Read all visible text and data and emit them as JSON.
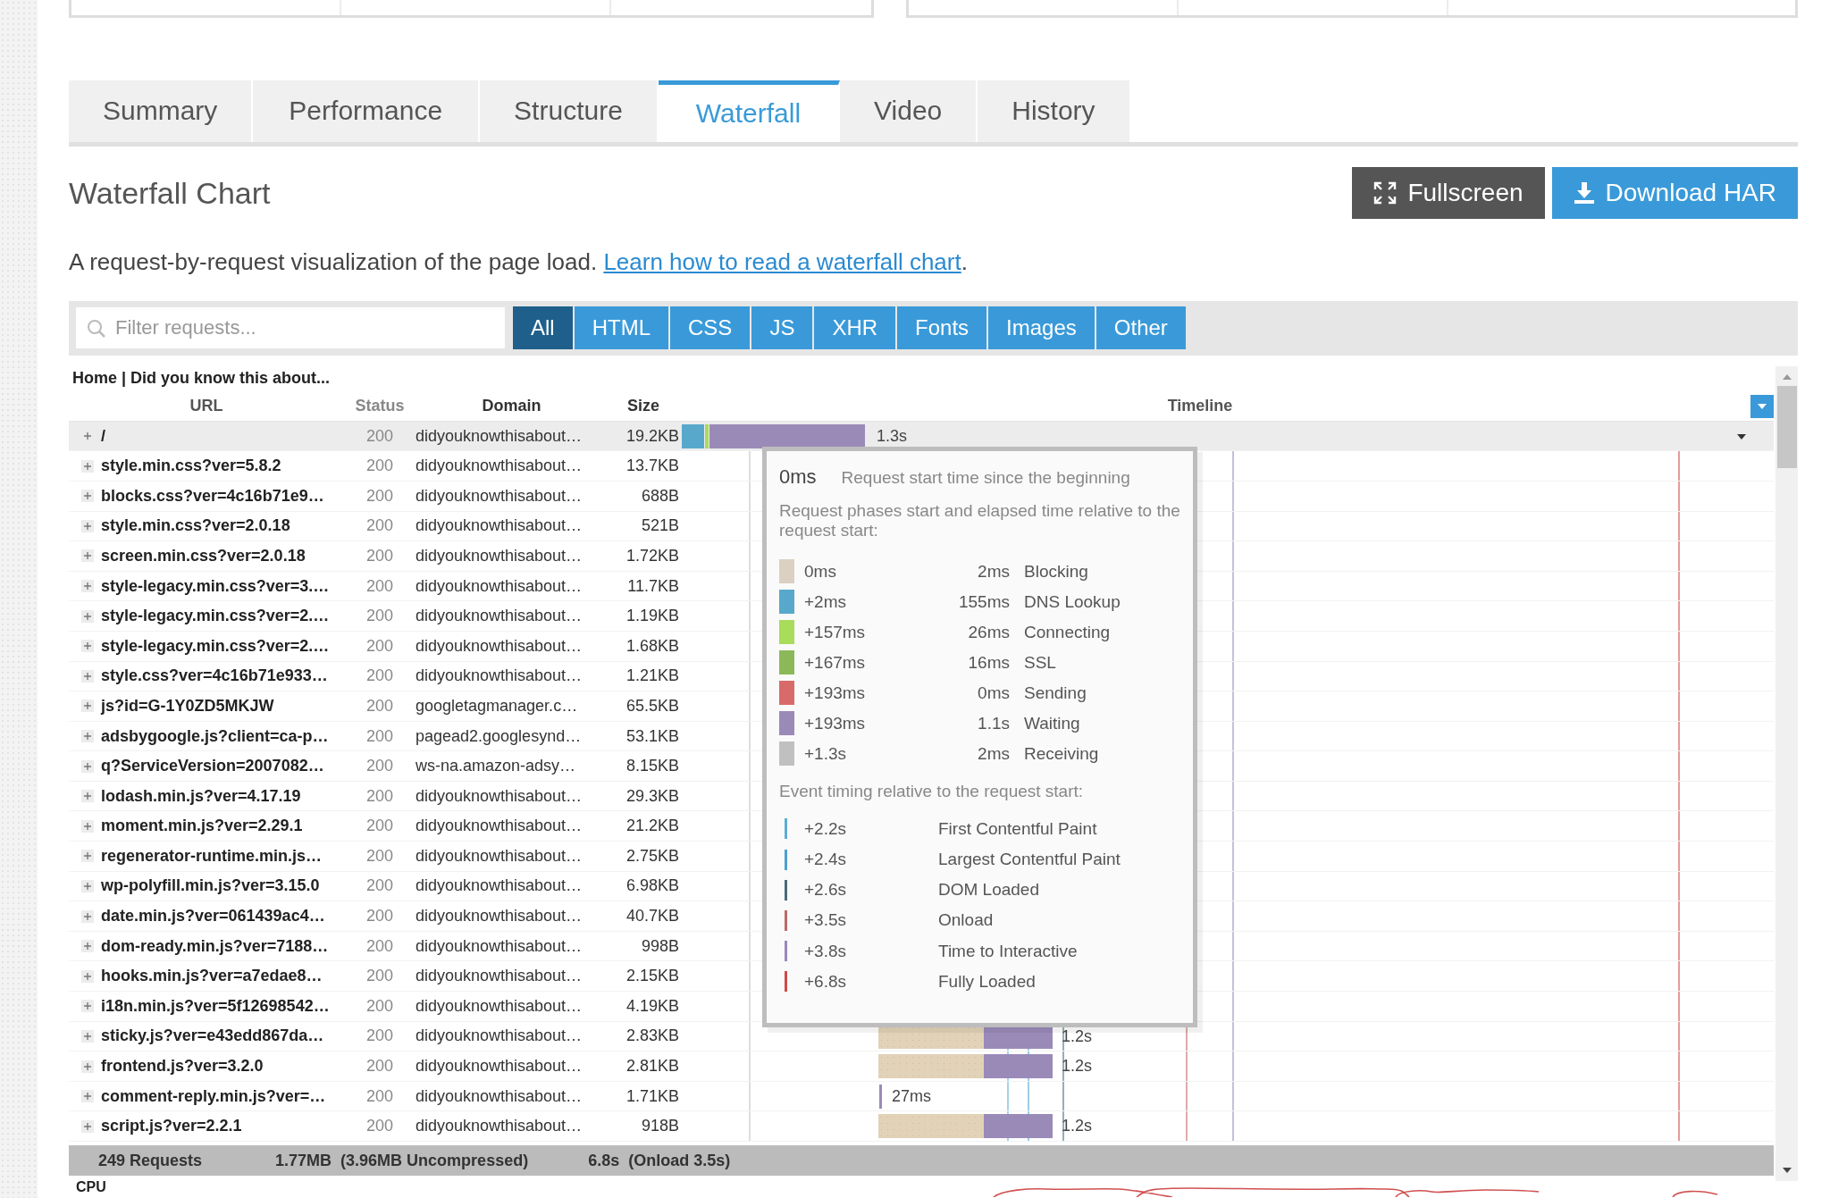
{
  "top_tabs": [
    {
      "label": "Summary",
      "selected": false
    },
    {
      "label": "Performance",
      "selected": false
    },
    {
      "label": "Structure",
      "selected": false
    },
    {
      "label": "Waterfall",
      "selected": true
    },
    {
      "label": "Video",
      "selected": false
    },
    {
      "label": "History",
      "selected": false
    }
  ],
  "heading": "Waterfall Chart",
  "buttons": [
    {
      "kind": "fullscreen",
      "label": "Fullscreen"
    },
    {
      "kind": "download",
      "label": "Download HAR"
    }
  ],
  "description": {
    "text": "A request-by-request visualization of the page load.",
    "link": "Learn how to read a waterfall chart",
    "end": "."
  },
  "filter": {
    "placeholder": "Filter requests..."
  },
  "type_filters": [
    {
      "label": "All",
      "selected": true
    },
    {
      "label": "HTML",
      "selected": false
    },
    {
      "label": "CSS",
      "selected": false
    },
    {
      "label": "JS",
      "selected": false
    },
    {
      "label": "XHR",
      "selected": false
    },
    {
      "label": "Fonts",
      "selected": false
    },
    {
      "label": "Images",
      "selected": false
    },
    {
      "label": "Other",
      "selected": false
    }
  ],
  "page_title": "Home | Did you know this about...",
  "table": {
    "columns": [
      "URL",
      "Status",
      "Domain",
      "Size",
      "Timeline"
    ],
    "rows": [
      {
        "url": "/",
        "status": "200",
        "domain": "didyouknowthisabout…",
        "size": "19.2KB",
        "selected": true,
        "bar": {
          "kind": "document",
          "label": "1.3s"
        }
      },
      {
        "url": "style.min.css?ver=5.8.2",
        "status": "200",
        "domain": "didyouknowthisabout…",
        "size": "13.7KB",
        "selected": false
      },
      {
        "url": "blocks.css?ver=4c16b71e9…",
        "status": "200",
        "domain": "didyouknowthisabout…",
        "size": "688B",
        "selected": false
      },
      {
        "url": "style.min.css?ver=2.0.18",
        "status": "200",
        "domain": "didyouknowthisabout…",
        "size": "521B",
        "selected": false
      },
      {
        "url": "screen.min.css?ver=2.0.18",
        "status": "200",
        "domain": "didyouknowthisabout…",
        "size": "1.72KB",
        "selected": false
      },
      {
        "url": "style-legacy.min.css?ver=3.…",
        "status": "200",
        "domain": "didyouknowthisabout…",
        "size": "11.7KB",
        "selected": false
      },
      {
        "url": "style-legacy.min.css?ver=2.…",
        "status": "200",
        "domain": "didyouknowthisabout…",
        "size": "1.19KB",
        "selected": false
      },
      {
        "url": "style-legacy.min.css?ver=2.…",
        "status": "200",
        "domain": "didyouknowthisabout…",
        "size": "1.68KB",
        "selected": false
      },
      {
        "url": "style.css?ver=4c16b71e933…",
        "status": "200",
        "domain": "didyouknowthisabout…",
        "size": "1.21KB",
        "selected": false
      },
      {
        "url": "js?id=G-1Y0ZD5MKJW",
        "status": "200",
        "domain": "googletagmanager.c…",
        "size": "65.5KB",
        "selected": false
      },
      {
        "url": "adsbygoogle.js?client=ca-p…",
        "status": "200",
        "domain": "pagead2.googlesynd…",
        "size": "53.1KB",
        "selected": false
      },
      {
        "url": "q?ServiceVersion=2007082…",
        "status": "200",
        "domain": "ws-na.amazon-adsy…",
        "size": "8.15KB",
        "selected": false
      },
      {
        "url": "lodash.min.js?ver=4.17.19",
        "status": "200",
        "domain": "didyouknowthisabout…",
        "size": "29.3KB",
        "selected": false
      },
      {
        "url": "moment.min.js?ver=2.29.1",
        "status": "200",
        "domain": "didyouknowthisabout…",
        "size": "21.2KB",
        "selected": false
      },
      {
        "url": "regenerator-runtime.min.js…",
        "status": "200",
        "domain": "didyouknowthisabout…",
        "size": "2.75KB",
        "selected": false
      },
      {
        "url": "wp-polyfill.min.js?ver=3.15.0",
        "status": "200",
        "domain": "didyouknowthisabout…",
        "size": "6.98KB",
        "selected": false
      },
      {
        "url": "date.min.js?ver=061439ac4…",
        "status": "200",
        "domain": "didyouknowthisabout…",
        "size": "40.7KB",
        "selected": false
      },
      {
        "url": "dom-ready.min.js?ver=7188…",
        "status": "200",
        "domain": "didyouknowthisabout…",
        "size": "998B",
        "selected": false
      },
      {
        "url": "hooks.min.js?ver=a7edae8…",
        "status": "200",
        "domain": "didyouknowthisabout…",
        "size": "2.15KB",
        "selected": false
      },
      {
        "url": "i18n.min.js?ver=5f12698542…",
        "status": "200",
        "domain": "didyouknowthisabout…",
        "size": "4.19KB",
        "selected": false
      },
      {
        "url": "sticky.js?ver=e43edd867da…",
        "status": "200",
        "domain": "didyouknowthisabout…",
        "size": "2.83KB",
        "selected": false,
        "bar": {
          "kind": "queued",
          "label": "1.2s"
        }
      },
      {
        "url": "frontend.js?ver=3.2.0",
        "status": "200",
        "domain": "didyouknowthisabout…",
        "size": "2.81KB",
        "selected": false,
        "bar": {
          "kind": "queued",
          "label": "1.2s"
        }
      },
      {
        "url": "comment-reply.min.js?ver=…",
        "status": "200",
        "domain": "didyouknowthisabout…",
        "size": "1.71KB",
        "selected": false,
        "bar": {
          "kind": "tick",
          "label": "27ms"
        }
      },
      {
        "url": "script.js?ver=2.2.1",
        "status": "200",
        "domain": "didyouknowthisabout…",
        "size": "918B",
        "selected": false,
        "bar": {
          "kind": "queued",
          "label": "1.2s"
        }
      }
    ]
  },
  "footer": {
    "requests": "249 Requests",
    "size": "1.77MB  (3.96MB Uncompressed)",
    "time": "6.8s  (Onload 3.5s)"
  },
  "cpu_label": "CPU",
  "tooltip": {
    "start": "0ms",
    "start_label": "Request start time since the beginning",
    "phases_heading": "Request phases start and elapsed time relative to the request start:",
    "phases": [
      {
        "start": "0ms",
        "duration": "2ms",
        "name": "Blocking",
        "color": "#dcd0c2"
      },
      {
        "start": "+2ms",
        "duration": "155ms",
        "name": "DNS Lookup",
        "color": "#58a8cc"
      },
      {
        "start": "+157ms",
        "duration": "26ms",
        "name": "Connecting",
        "color": "#a8dc5a"
      },
      {
        "start": "+167ms",
        "duration": "16ms",
        "name": "SSL",
        "color": "#8cb85a"
      },
      {
        "start": "+193ms",
        "duration": "0ms",
        "name": "Sending",
        "color": "#d86a6a"
      },
      {
        "start": "+193ms",
        "duration": "1.1s",
        "name": "Waiting",
        "color": "#9a8ab8"
      },
      {
        "start": "+1.3s",
        "duration": "2ms",
        "name": "Receiving",
        "color": "#c0c0c0"
      }
    ],
    "events_heading": "Event timing relative to the request start:",
    "events": [
      {
        "time": "+2.2s",
        "name": "First Contentful Paint",
        "color": "#5aaed6"
      },
      {
        "time": "+2.4s",
        "name": "Largest Contentful Paint",
        "color": "#4aa0d0"
      },
      {
        "time": "+2.6s",
        "name": "DOM Loaded",
        "color": "#4a6a7a"
      },
      {
        "time": "+3.5s",
        "name": "Onload",
        "color": "#c06868"
      },
      {
        "time": "+3.8s",
        "name": "Time to Interactive",
        "color": "#9a88c0"
      },
      {
        "time": "+6.8s",
        "name": "Fully Loaded",
        "color": "#d04848"
      }
    ]
  }
}
